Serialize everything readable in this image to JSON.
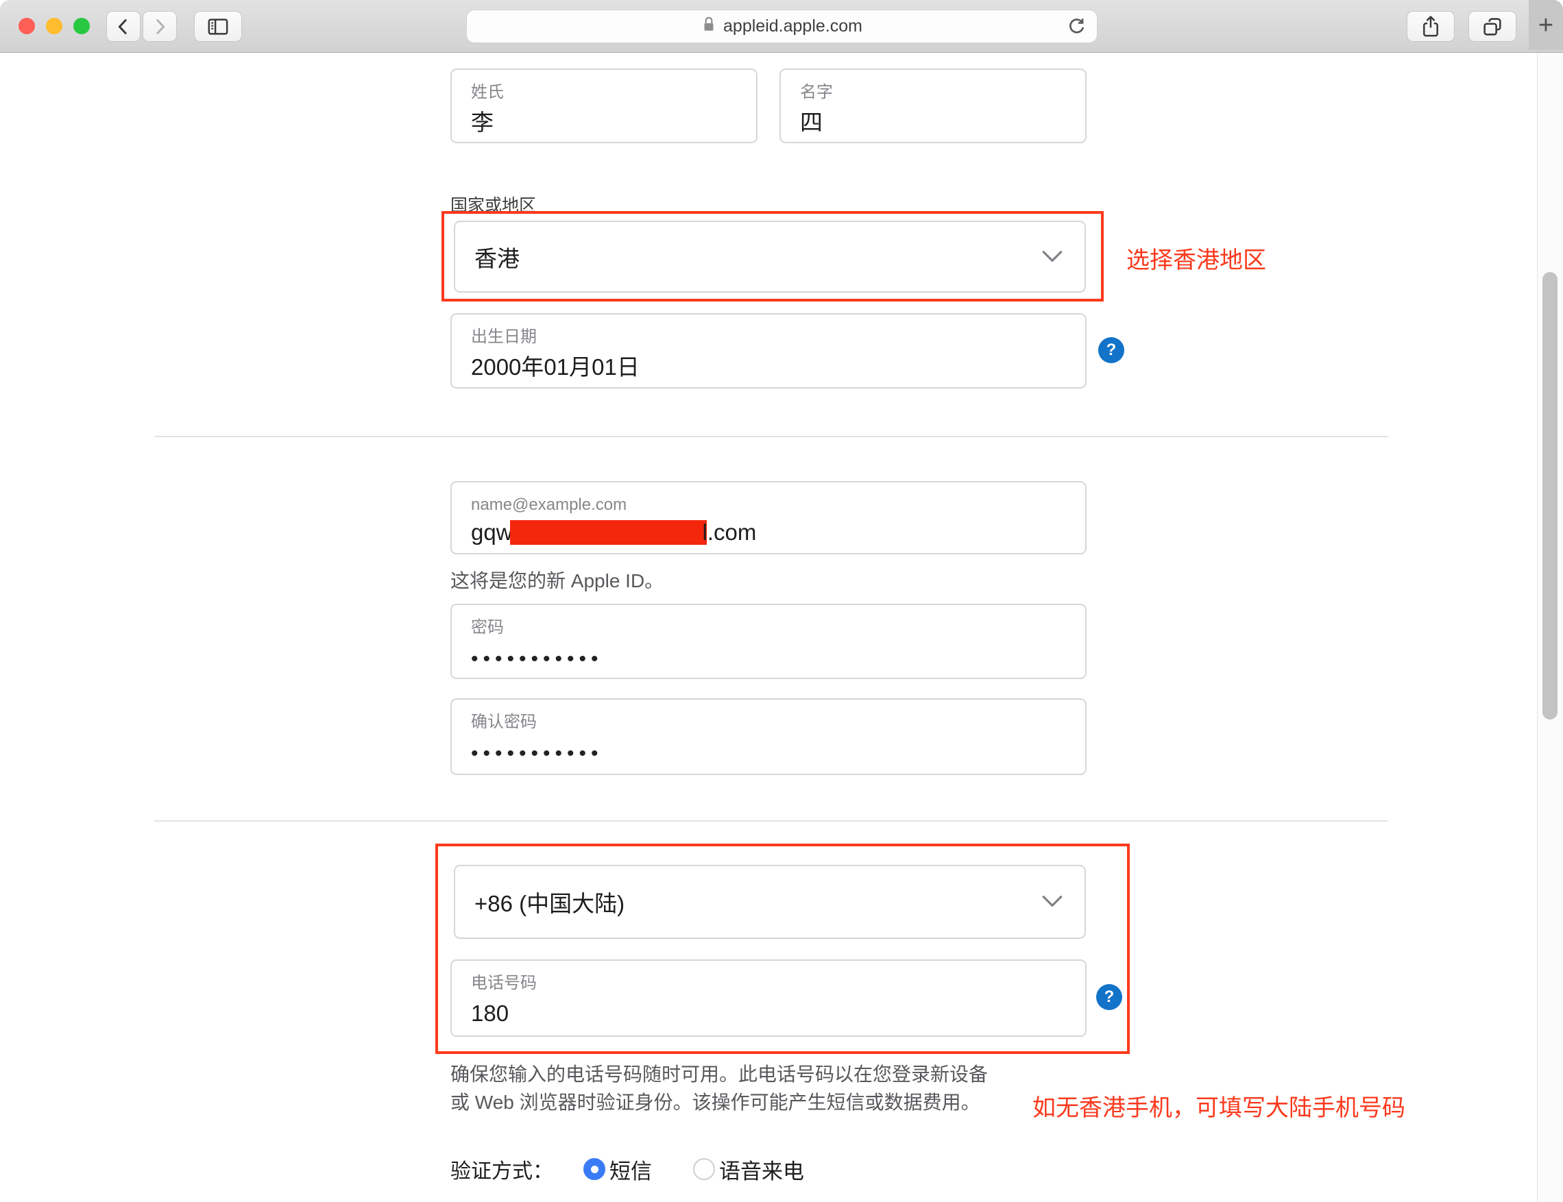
{
  "browser": {
    "url": "appleid.apple.com",
    "new_tab": "+"
  },
  "form": {
    "last_name": {
      "label": "姓氏",
      "value": "李"
    },
    "first_name": {
      "label": "名字",
      "value": "四"
    },
    "region_label": "国家或地区",
    "region_value": "香港",
    "birth": {
      "label": "出生日期",
      "value": "2000年01月01日"
    },
    "email": {
      "placeholder": "name@example.com",
      "prefix": "gqw",
      "suffix": "l.com"
    },
    "apple_id_note": "这将是您的新 Apple ID。",
    "password": {
      "label": "密码",
      "masked": "•••••••••••"
    },
    "confirm": {
      "label": "确认密码",
      "masked": "•••••••••••"
    },
    "phone_code": "+86 (中国大陆)",
    "phone": {
      "label": "电话号码",
      "value": "180"
    },
    "phone_note1": "确保您输入的电话号码随时可用。此电话号码以在您登录新设备",
    "phone_note2": "或 Web 浏览器时验证身份。该操作可能产生短信或数据费用。",
    "verify_label": "验证方式：",
    "verify_options": [
      {
        "label": "短信",
        "selected": true
      },
      {
        "label": "语音来电",
        "selected": false
      }
    ],
    "help": "?"
  },
  "annotations": {
    "region_tip": "选择香港地区",
    "phone_tip": "如无香港手机，可填写大陆手机号码"
  },
  "colors": {
    "annotation_red": "#fb391d",
    "redaction_red": "#f4270d",
    "help_blue": "#1273c8",
    "radio_blue": "#3a7bf6"
  }
}
